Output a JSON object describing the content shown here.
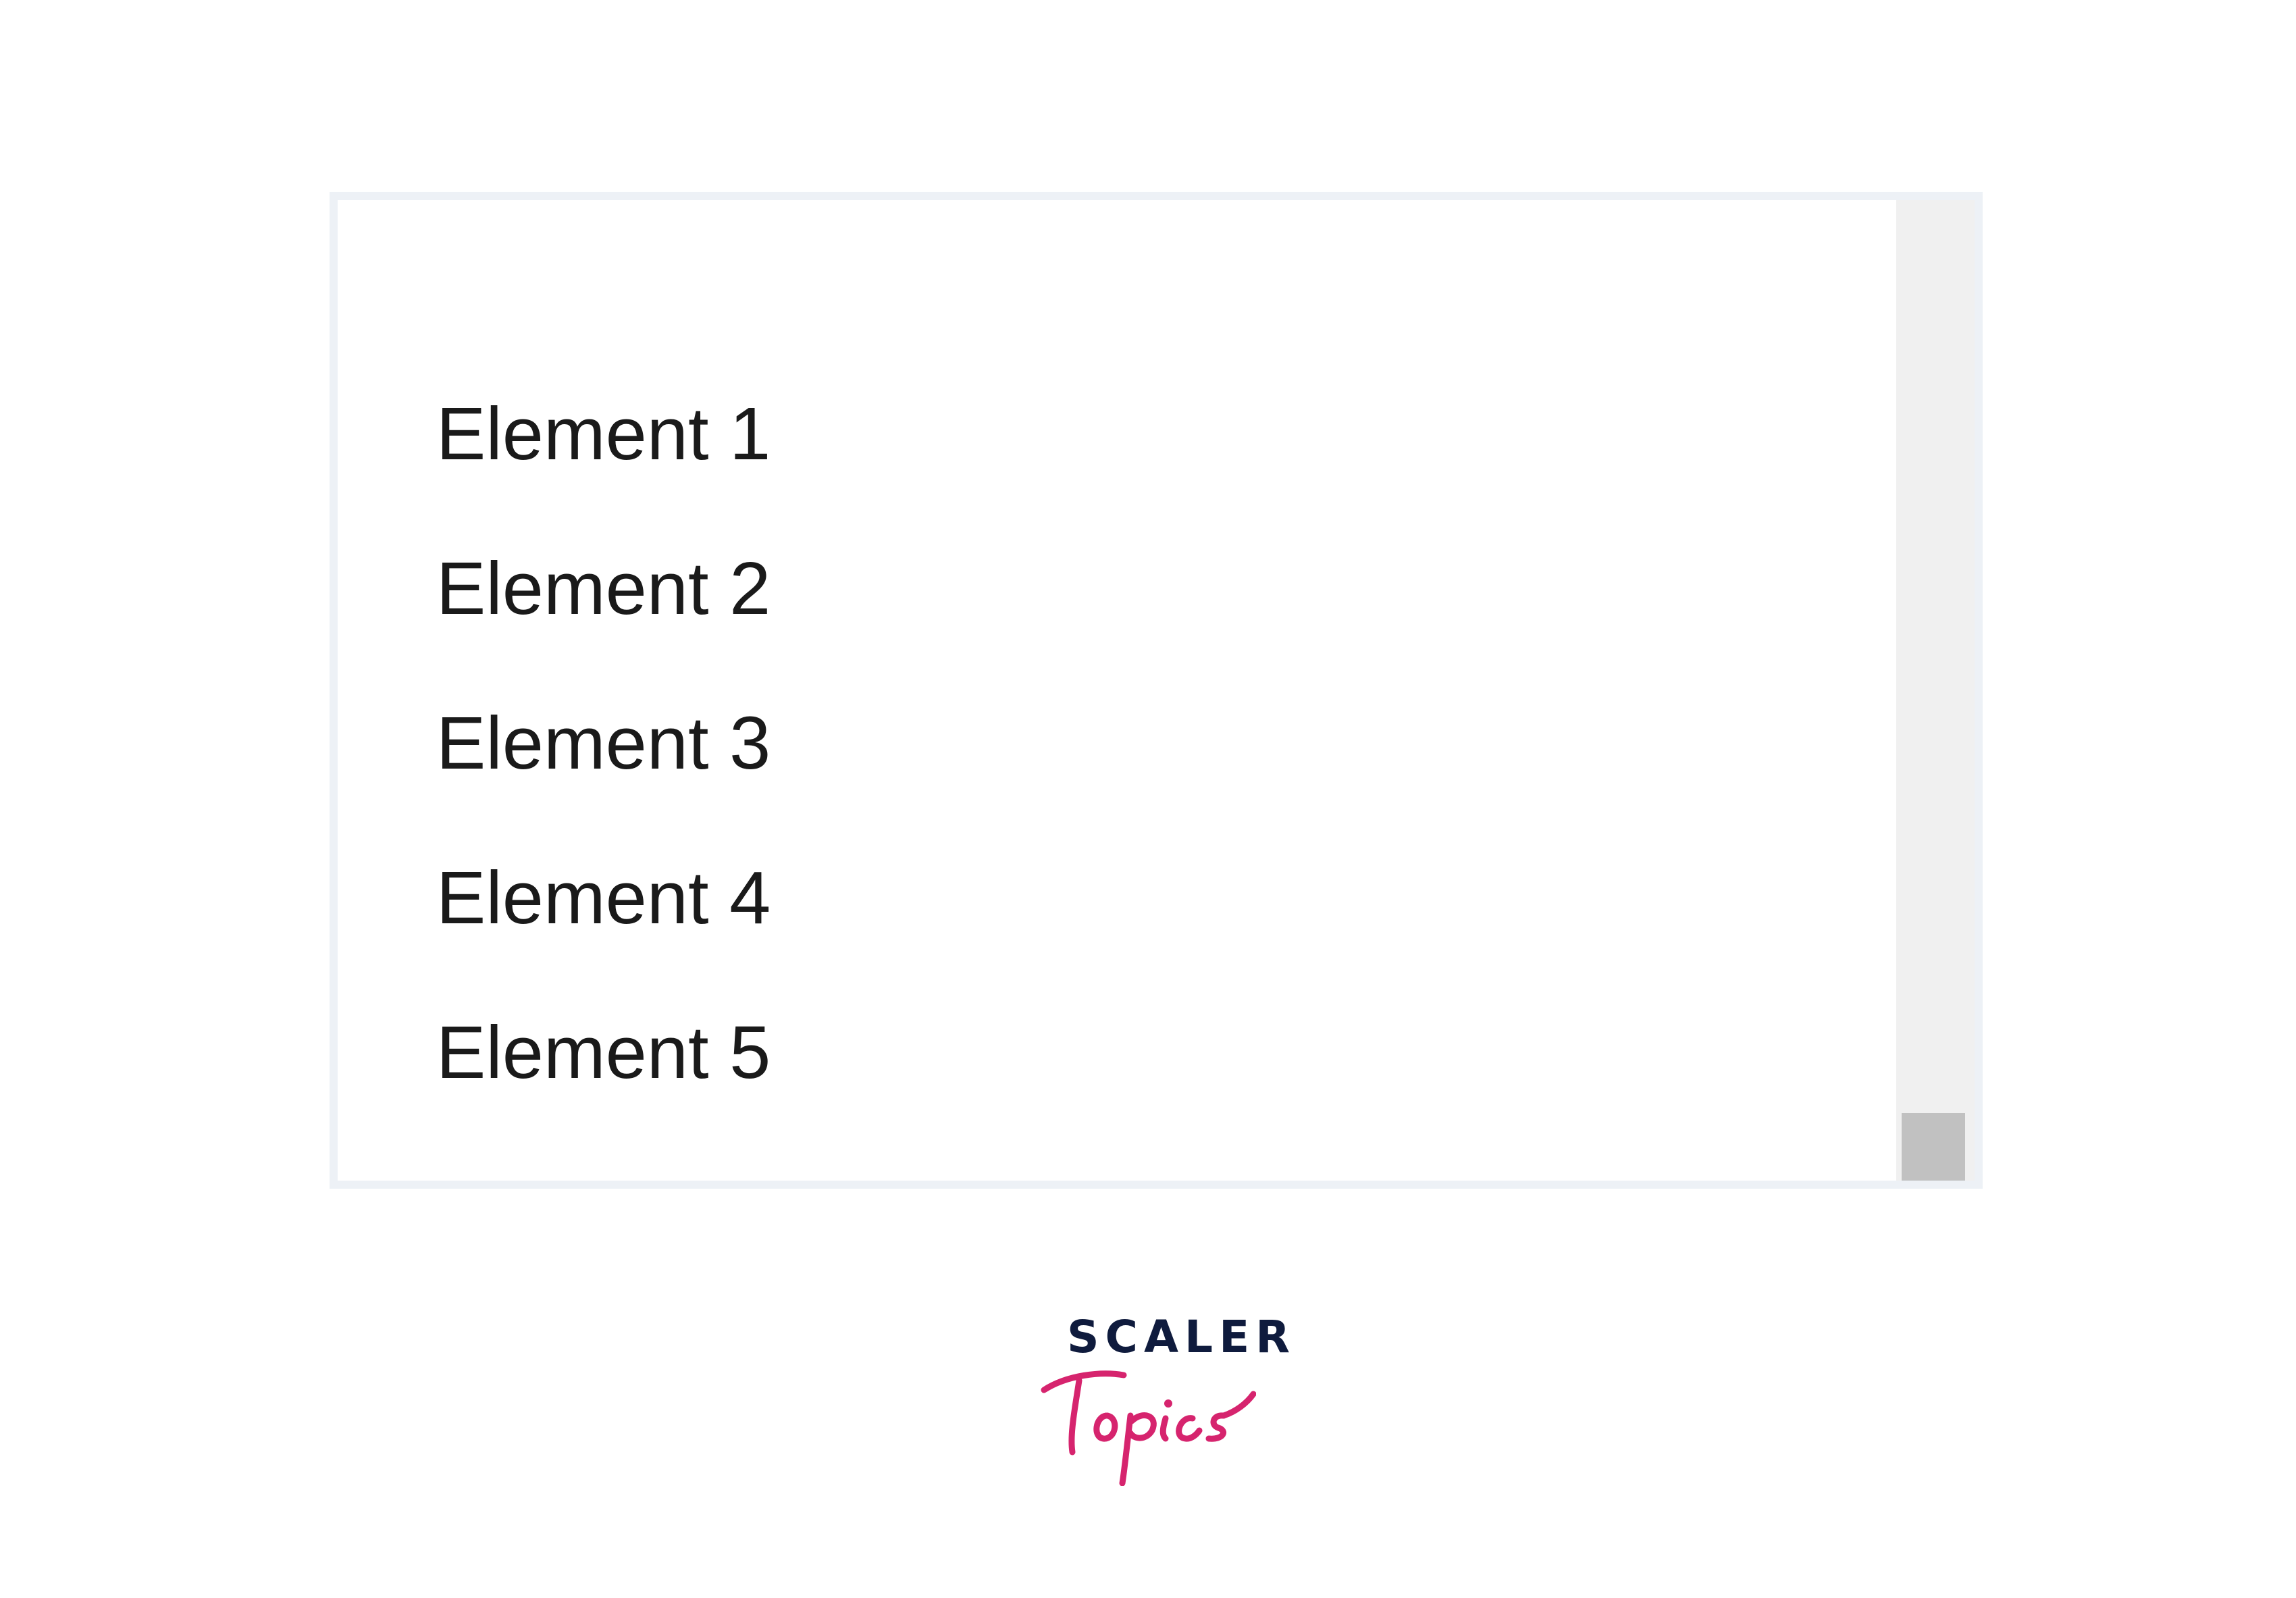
{
  "list": {
    "items": [
      {
        "label": "Element 1"
      },
      {
        "label": "Element 2"
      },
      {
        "label": "Element 3"
      },
      {
        "label": "Element 4"
      },
      {
        "label": "Element 5"
      }
    ]
  },
  "scrollbar": {
    "position": 1.0
  },
  "branding": {
    "brand_top": "SCALER",
    "brand_script": "Topics",
    "colors": {
      "top": "#0f1b3d",
      "script": "#d6246e"
    }
  },
  "colors": {
    "frame_border": "#edf1f6",
    "track": "#f0f0f0",
    "thumb": "#c1c1c1",
    "text": "#1a1a1a"
  }
}
